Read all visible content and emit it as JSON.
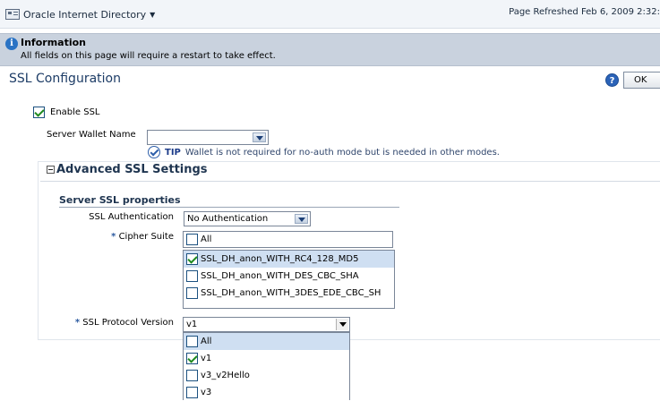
{
  "topbar": {
    "app_name": "Oracle Internet Directory",
    "refreshed": "Page Refreshed Feb 6, 2009 2:32:"
  },
  "info": {
    "title": "Information",
    "message": "All fields on this page will require a restart to take effect."
  },
  "page": {
    "title": "SSL Configuration",
    "ok_label": "OK",
    "help_label": "?"
  },
  "enable_ssl": {
    "label": "Enable SSL",
    "checked": true
  },
  "wallet": {
    "label": "Server Wallet Name",
    "value": "",
    "tip_label": "TIP",
    "tip_text": "Wallet is not required for no-auth mode but is needed in other modes."
  },
  "advanced": {
    "title": "Advanced SSL Settings",
    "server_ssl_title": "Server SSL properties",
    "auth_label": "SSL Authentication",
    "auth_value": "No Authentication",
    "cipher_label": "Cipher Suite",
    "required_mark": "*",
    "cipher_all_label": "All",
    "ciphers": [
      {
        "label": "SSL_DH_anon_WITH_RC4_128_MD5",
        "checked": true
      },
      {
        "label": "SSL_DH_anon_WITH_DES_CBC_SHA",
        "checked": false
      },
      {
        "label": "SSL_DH_anon_WITH_3DES_EDE_CBC_SH",
        "checked": false
      }
    ],
    "protocol_label": "SSL Protocol Version",
    "protocol_value": "v1",
    "protocols": [
      {
        "label": "All",
        "checked": false
      },
      {
        "label": "v1",
        "checked": true
      },
      {
        "label": "v3_v2Hello",
        "checked": false
      },
      {
        "label": "v3",
        "checked": false
      }
    ]
  },
  "colors": {
    "info_banner": "#c9d2de",
    "title_text": "#1d3c66",
    "selected_row": "#cfdff2"
  }
}
